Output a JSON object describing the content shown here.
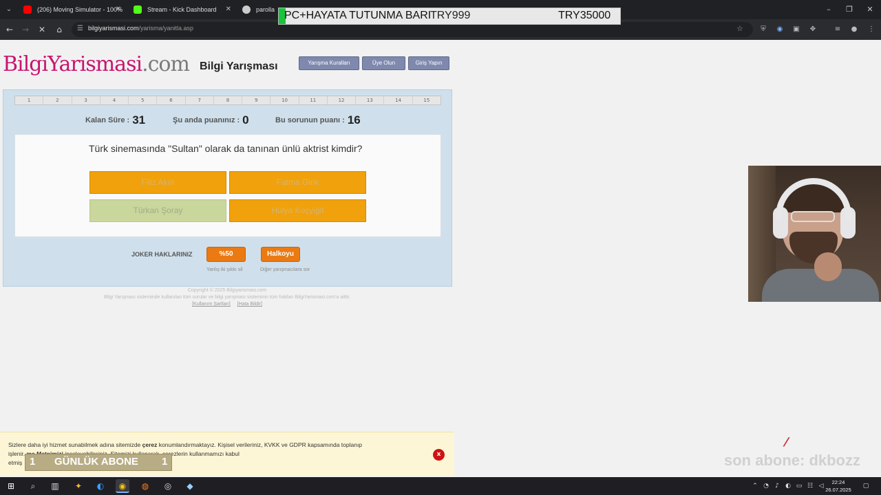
{
  "browser": {
    "tabs": [
      {
        "title": "(206) Moving Simulator - 100%",
        "favicon_color": "#ff0000"
      },
      {
        "title": "Stream - Kick Dashboard",
        "favicon_color": "#53fc18"
      },
      {
        "title": "parolla - Ki",
        "favicon_color": "#cccccc"
      }
    ],
    "url_host": "bilgiyarismasi.com",
    "url_path": "/yarisma/yanitla.asp"
  },
  "overlay": {
    "bar_text": "PC+HAYATA TUTUNMA BARI",
    "left_amount": "TRY999",
    "right_amount": "TRY35000"
  },
  "site": {
    "logo_part1": "Bilgi",
    "logo_part2": "Yarismasi",
    "logo_part3": ".com",
    "title": "Bilgi Yarışması",
    "nav": {
      "rules": "Yarışma Kuralları",
      "signup": "Üye Olun",
      "login": "Giriş Yapın"
    }
  },
  "quiz": {
    "question_numbers": [
      "1",
      "2",
      "3",
      "4",
      "5",
      "6",
      "7",
      "8",
      "9",
      "10",
      "11",
      "12",
      "13",
      "14",
      "15"
    ],
    "time_left_label": "Kalan Süre :",
    "time_left_value": "31",
    "current_score_label": "Şu anda puanınız :",
    "current_score_value": "0",
    "question_points_label": "Bu sorunun puanı :",
    "question_points_value": "16",
    "question": "Türk sinemasında \"Sultan\" olarak da tanınan ünlü aktrist kimdir?",
    "answers": [
      "Filiz Akın",
      "Fatma Girik",
      "Türkan Şoray",
      "Hülya Koçyiğit"
    ],
    "joker_label": "JOKER HAKLARINIZ",
    "joker_50": "%50",
    "joker_50_sub": "Yanlış iki şıkkı sil",
    "joker_audience": "Halkoyu",
    "joker_audience_sub": "Diğer yarışmacılara sor"
  },
  "footer": {
    "copyright": "Copyright © 2025 Bilgiyarismasi.com",
    "rights": "Bilgi Yarışması sisteminde kullanılan tüm sorular ve bilgi yarışması sisteminin tüm hakları BilgiYarismasi.com'a aittir.",
    "terms_link": "[Kullanım Şartları]",
    "report_link": "[Hata Bildir]"
  },
  "cookie": {
    "line1_a": "Sizlere daha iyi hizmet sunabilmek adına sitemizde ",
    "line1_b": "çerez",
    "line1_c": " konumlandırmaktayız. Kişisel verileriniz, KVKK ve GDPR kapsamında toplanıp",
    "line2_a": "işlenir. ",
    "line2_b": "ma Metnimizi",
    "line2_c": " inceleyebilirsiniz. Sitemizi kullanarak, çerezlerin kullanmamızı kabul",
    "line3": "etmiş",
    "close": "x"
  },
  "stream": {
    "daily_sub_left": "1",
    "daily_sub_label": "GÜNLÜK ABONE",
    "daily_sub_right": "1",
    "last_sub": "son abone: dkbozz"
  },
  "taskbar": {
    "time": "22:24",
    "date": "26.07.2025"
  }
}
